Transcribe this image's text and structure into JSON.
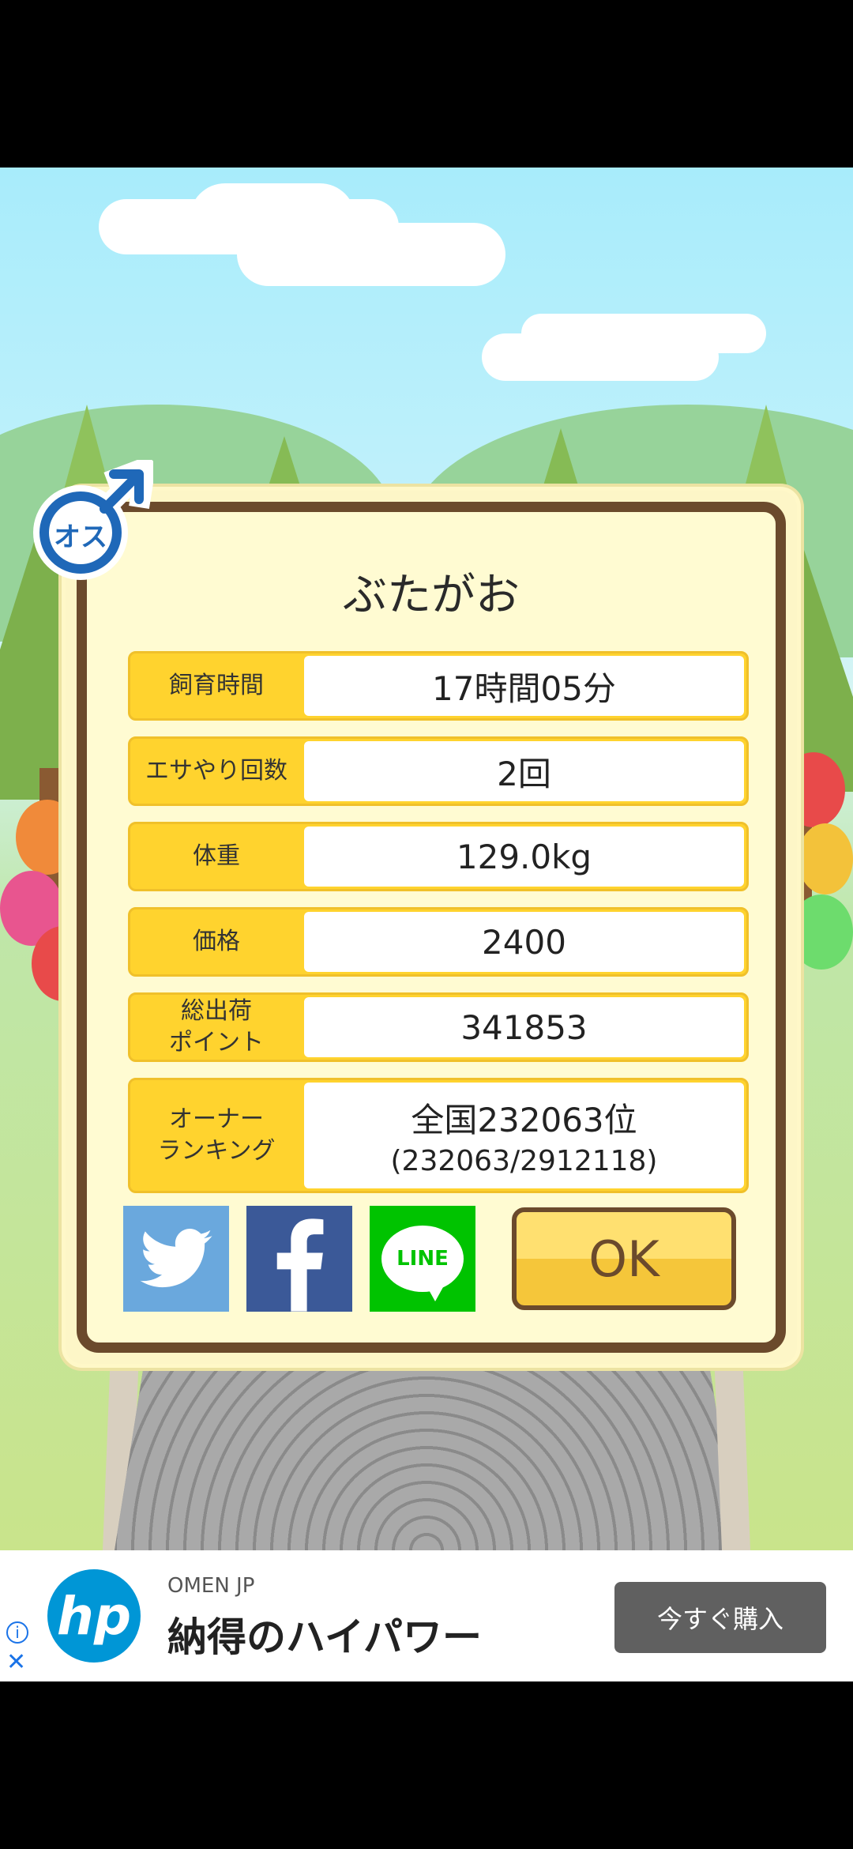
{
  "dialog": {
    "title": "ぶたがお",
    "gender_badge": "オス",
    "rows": [
      {
        "label": "飼育時間",
        "value": "17時間05分"
      },
      {
        "label": "エサやり回数",
        "value": "2回"
      },
      {
        "label": "体重",
        "value": "129.0kg"
      },
      {
        "label": "価格",
        "value": "2400"
      },
      {
        "label": "総出荷\nポイント",
        "value": "341853"
      },
      {
        "label": "オーナー\nランキング",
        "value": "全国232063位",
        "sub": "(232063/2912118)"
      }
    ],
    "share": {
      "twitter_color": "#6aa8dd",
      "facebook_color": "#3b5998",
      "line_label": "LINE",
      "line_color": "#00c300"
    },
    "ok_label": "OK"
  },
  "ad": {
    "logo_text": "hp",
    "brand": "OMEN JP",
    "headline": "納得のハイパワー",
    "cta": "今すぐ購入",
    "info_icon": "i",
    "close_icon": "✕"
  }
}
